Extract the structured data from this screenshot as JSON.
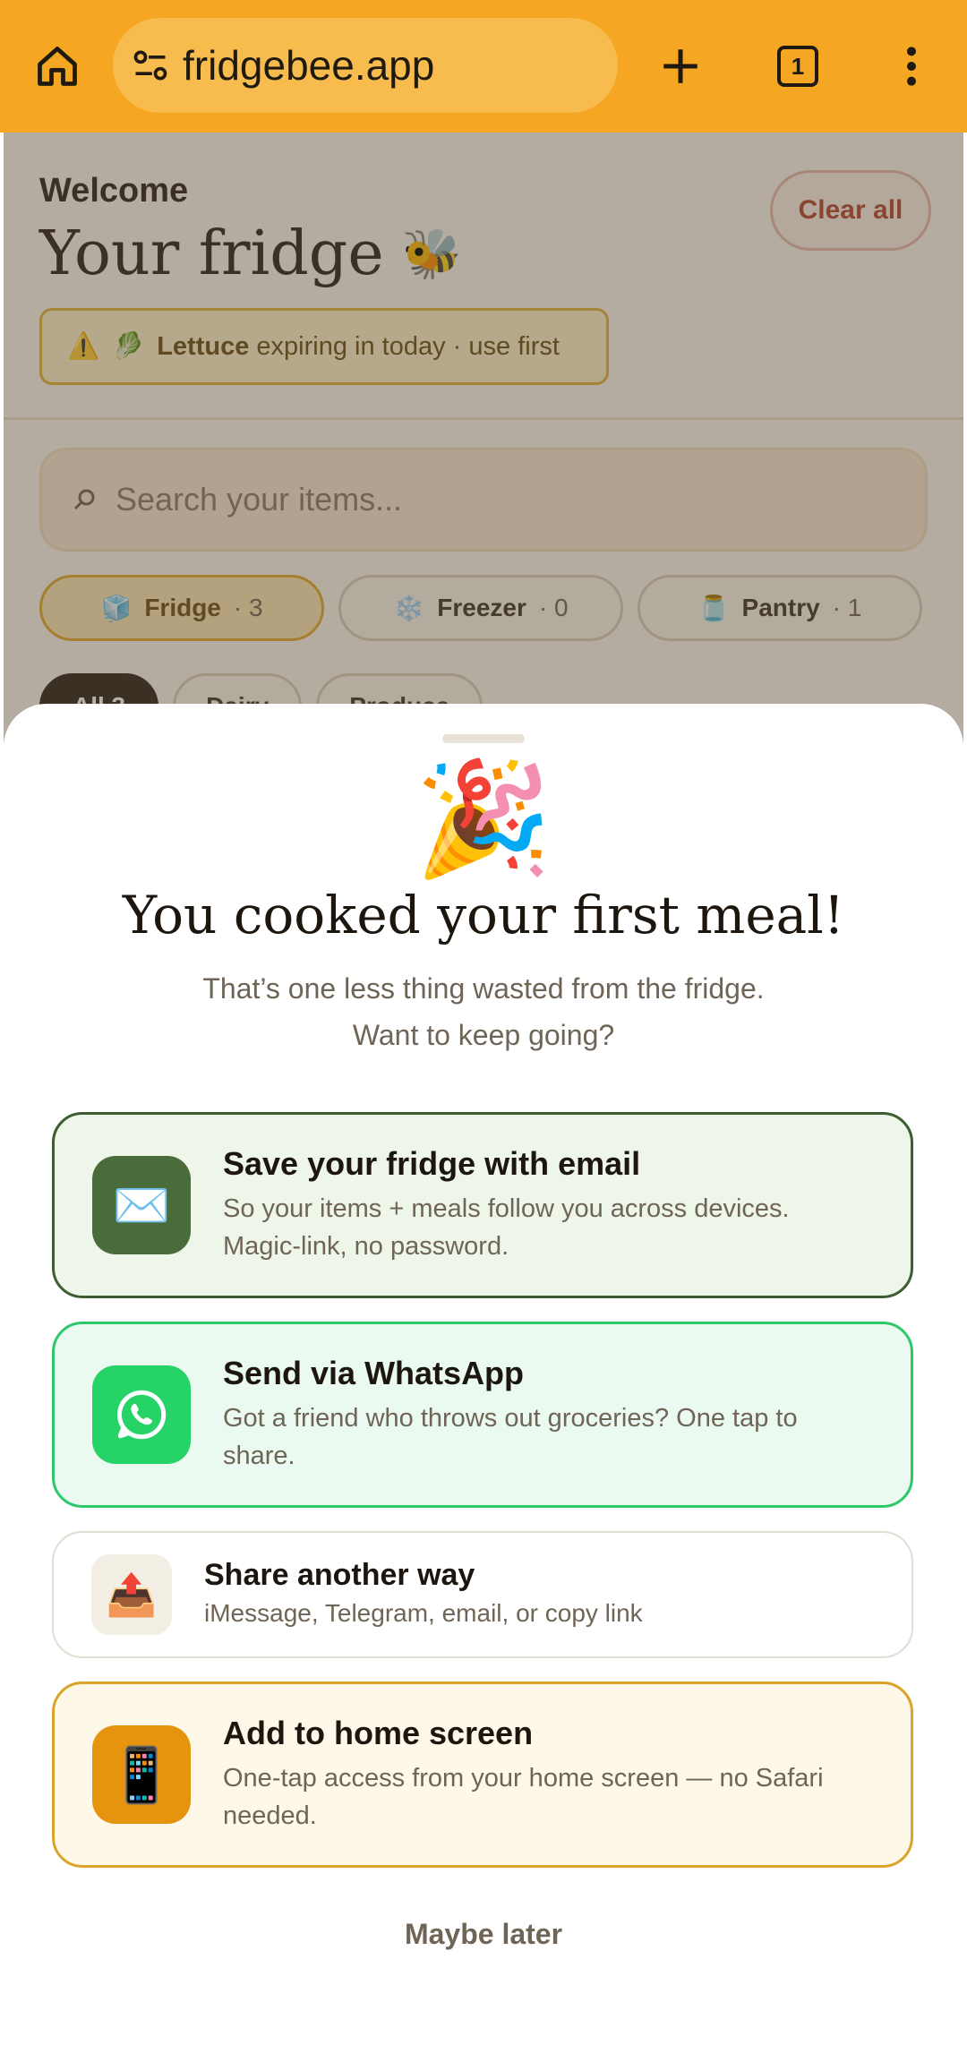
{
  "browser": {
    "url": "fridgebee.app",
    "tab_count": "1"
  },
  "app": {
    "welcome": "Welcome",
    "title": "Your fridge",
    "bee_emoji": "🐝",
    "clear_all": "Clear all",
    "expiry": {
      "warning_emoji": "⚠️",
      "item_emoji": "🥬",
      "item": "Lettuce",
      "text": "expiring in today · use first"
    },
    "search_placeholder": "Search your items...",
    "storage_chips": [
      {
        "emoji": "🧊",
        "label": "Fridge",
        "count": "· 3"
      },
      {
        "emoji": "❄️",
        "label": "Freezer",
        "count": "· 0"
      },
      {
        "emoji": "🫙",
        "label": "Pantry",
        "count": "· 1"
      }
    ],
    "filter_chips": [
      {
        "label": "All 3"
      },
      {
        "label": "Dairy"
      },
      {
        "label": "Produce"
      }
    ]
  },
  "sheet": {
    "emoji": "🎉",
    "title": "You cooked your first meal!",
    "subtitle_line1": "That’s one less thing wasted from the fridge.",
    "subtitle_line2": "Want to keep going?",
    "email_card": {
      "icon": "✉️",
      "title": "Save your fridge with email",
      "desc_line1": "So your items + meals follow you across devices.",
      "desc_line2": "Magic-link, no password."
    },
    "whatsapp_card": {
      "title": "Send via WhatsApp",
      "desc_line1": "Got a friend who throws out groceries? One tap to",
      "desc_line2": "share."
    },
    "share_card": {
      "icon": "📤",
      "title": "Share another way",
      "desc": "iMessage, Telegram, email, or copy link"
    },
    "home_card": {
      "icon": "📱",
      "title": "Add to home screen",
      "desc_line1": "One-tap access from your home screen — no Safari",
      "desc_line2": "needed."
    },
    "maybe_later": "Maybe later"
  },
  "colors": {
    "browser_bar": "#f5a623",
    "email_accent": "#3e5d33",
    "whatsapp_accent": "#25d366",
    "home_accent": "#e69410"
  }
}
